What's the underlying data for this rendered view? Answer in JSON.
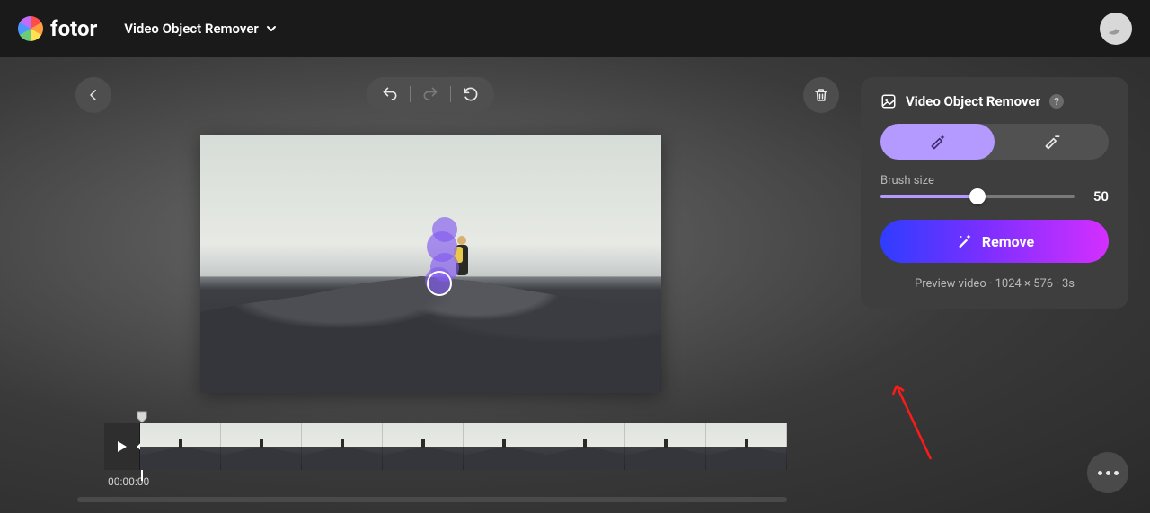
{
  "app": {
    "brand": "fotor",
    "tool_name": "Video Object Remover"
  },
  "panel": {
    "title": "Video Object Remover",
    "brush_label": "Brush size",
    "brush_value": "50",
    "brush_percent": 50,
    "remove_label": "Remove",
    "preview_meta": "Preview video · 1024 × 576 · 3s"
  },
  "timeline": {
    "timecode": "00:00:00"
  },
  "icons": {
    "back": "back-icon",
    "undo": "undo-icon",
    "redo": "redo-icon",
    "reset": "reset-icon",
    "delete": "trash-icon",
    "play": "play-icon",
    "help": "?",
    "brush_add": "brush-add-icon",
    "brush_sub": "brush-sub-icon",
    "wand": "wand-icon",
    "avatar": "bird-icon",
    "more": "more-icon",
    "chevron": "chevron-down-icon"
  }
}
